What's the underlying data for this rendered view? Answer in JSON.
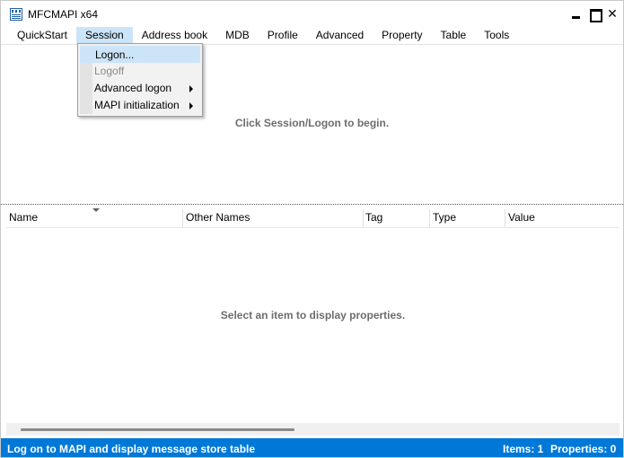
{
  "window": {
    "title": "MFCMAPI x64",
    "controls": {
      "minimize": "minimize",
      "maximize": "maximize",
      "close": "✕"
    }
  },
  "menubar": {
    "items": [
      {
        "label": "QuickStart"
      },
      {
        "label": "Session",
        "active": true
      },
      {
        "label": "Address book"
      },
      {
        "label": "MDB"
      },
      {
        "label": "Profile"
      },
      {
        "label": "Advanced"
      },
      {
        "label": "Property"
      },
      {
        "label": "Table"
      },
      {
        "label": "Tools"
      }
    ]
  },
  "session_menu": {
    "items": [
      {
        "label": "Logon...",
        "highlighted": true,
        "enabled": true
      },
      {
        "label": "Logoff",
        "enabled": false
      },
      {
        "label": "Advanced logon",
        "submenu": true,
        "enabled": true
      },
      {
        "label": "MAPI initialization",
        "submenu": true,
        "enabled": true
      }
    ]
  },
  "top_pane": {
    "hint": "Click Session/Logon to begin."
  },
  "property_list": {
    "columns": [
      "Name",
      "Other Names",
      "Tag",
      "Type",
      "Value"
    ],
    "rows": [],
    "empty_hint": "Select an item to display properties."
  },
  "statusbar": {
    "message": "Log on to MAPI and display message store table",
    "items": "Items: 1",
    "properties": "Properties: 0"
  },
  "colors": {
    "statusbar_bg": "#0078d7",
    "menu_highlight": "#cce4f7",
    "hint_text": "#6d6d6d"
  }
}
